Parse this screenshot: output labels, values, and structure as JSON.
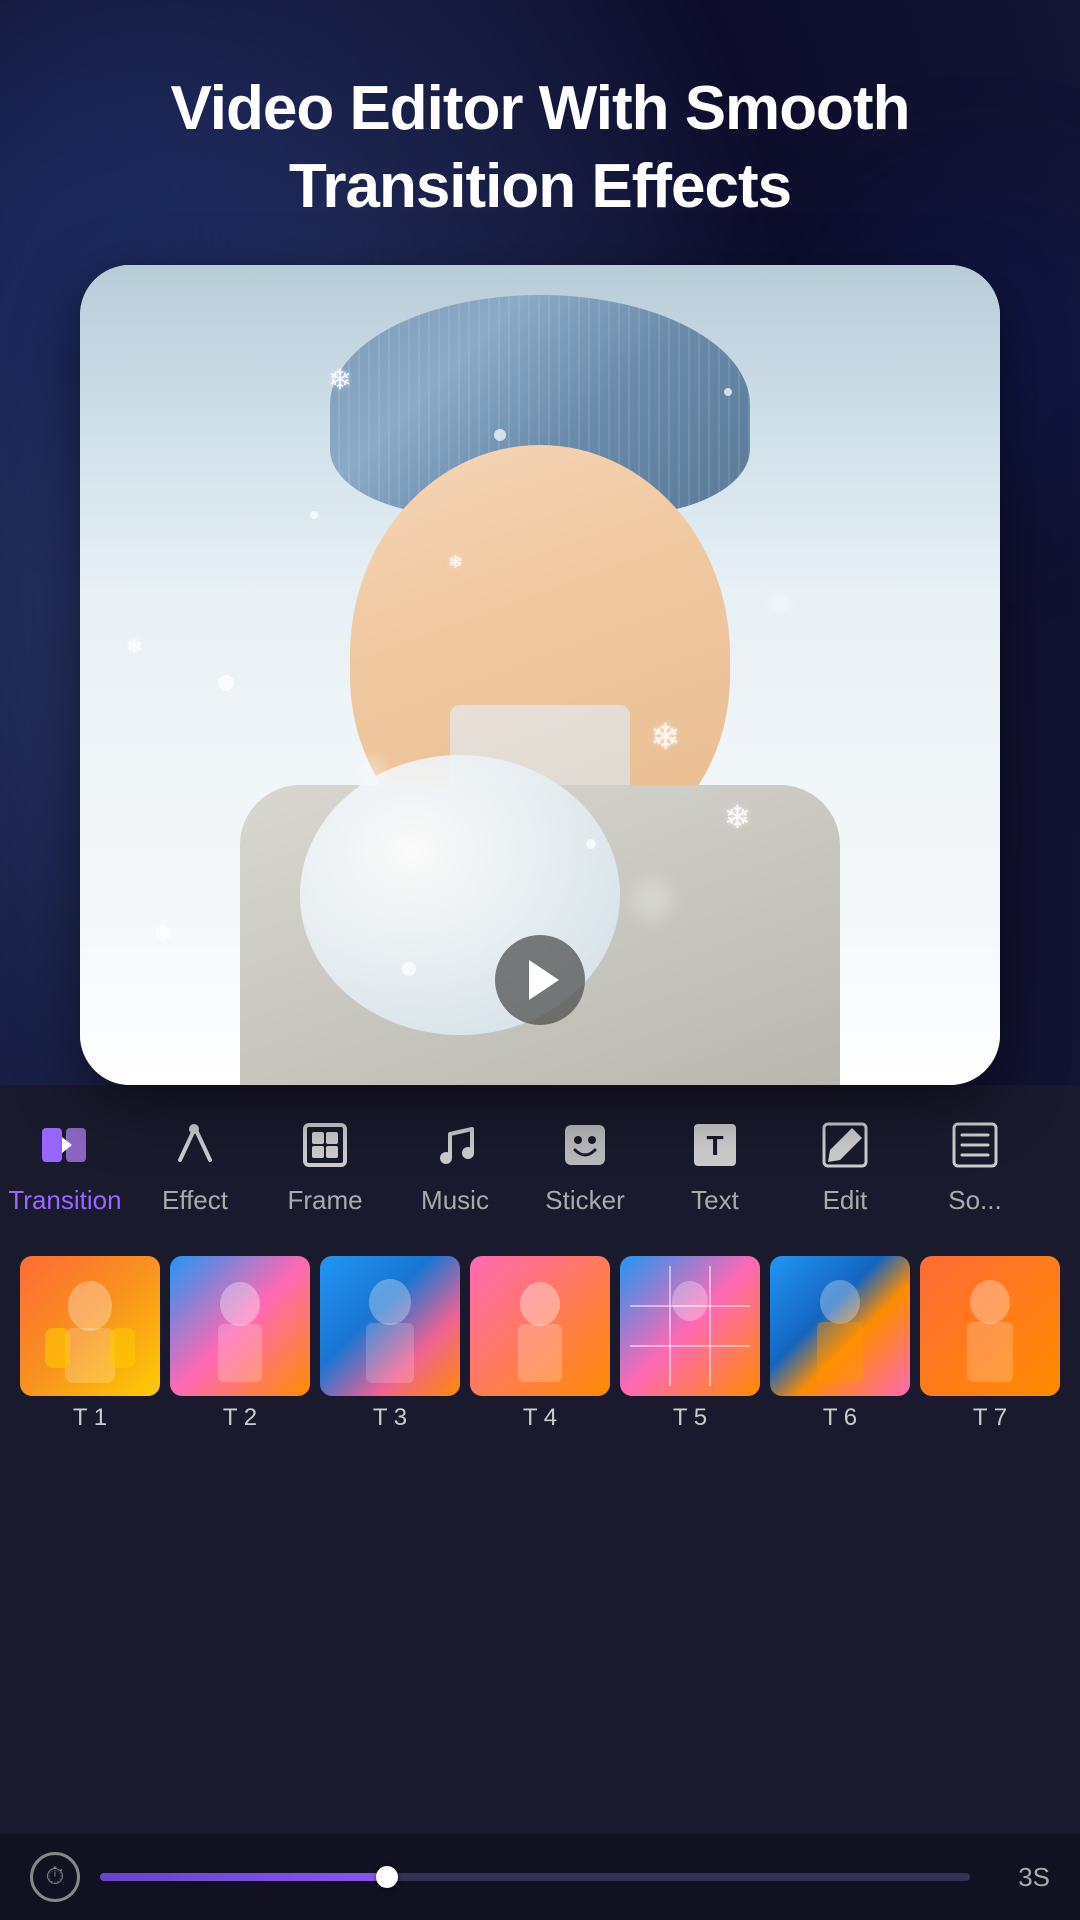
{
  "app": {
    "title": "Video Editor With Smooth Transition Effects"
  },
  "toolbar": {
    "items": [
      {
        "id": "transition",
        "label": "Transition",
        "icon": "transition",
        "active": true
      },
      {
        "id": "effect",
        "label": "Effect",
        "icon": "effect",
        "active": false
      },
      {
        "id": "frame",
        "label": "Frame",
        "icon": "frame",
        "active": false
      },
      {
        "id": "music",
        "label": "Music",
        "icon": "music",
        "active": false
      },
      {
        "id": "sticker",
        "label": "Sticker",
        "icon": "sticker",
        "active": false
      },
      {
        "id": "text",
        "label": "Text",
        "icon": "text",
        "active": false
      },
      {
        "id": "edit",
        "label": "Edit",
        "icon": "edit",
        "active": false
      },
      {
        "id": "sort",
        "label": "So...",
        "icon": "sort",
        "active": false
      }
    ]
  },
  "timeline": {
    "clips": [
      {
        "id": "t1",
        "label": "T 1",
        "theme": "warm"
      },
      {
        "id": "t2",
        "label": "T 2",
        "theme": "blue-pink"
      },
      {
        "id": "t3",
        "label": "T 3",
        "theme": "blue-dark"
      },
      {
        "id": "t4",
        "label": "T 4",
        "theme": "pink"
      },
      {
        "id": "t5",
        "label": "T 5",
        "theme": "grid"
      },
      {
        "id": "t6",
        "label": "T 6",
        "theme": "blue-orange"
      },
      {
        "id": "t7",
        "label": "T 7",
        "theme": "orange"
      }
    ]
  },
  "playback": {
    "duration": "3S",
    "progress": 33
  },
  "colors": {
    "accent": "#9966ff",
    "active_tab": "#8855ee",
    "bg_dark": "#1a1a2e",
    "toolbar_icon": "#dddddd",
    "inactive_label": "#aaaaaa"
  }
}
